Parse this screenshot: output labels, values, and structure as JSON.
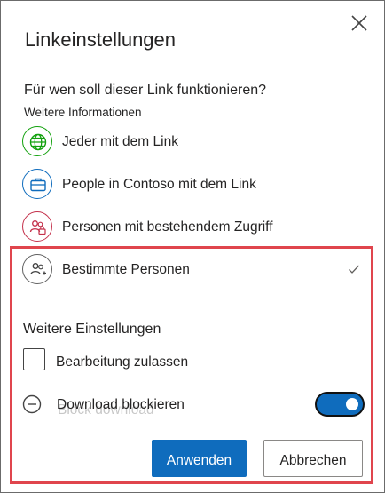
{
  "dialog": {
    "title": "Linkeinstellungen",
    "close_icon": "close-icon"
  },
  "audience": {
    "question": "Für wen soll dieser Link funktionieren?",
    "more_info": "Weitere Informationen",
    "options": [
      {
        "label": "Jeder mit dem Link",
        "icon": "globe-icon",
        "color": "#13a10e",
        "selected": false
      },
      {
        "label": "People in Contoso mit dem Link",
        "icon": "briefcase-icon",
        "color": "#0f6cbd",
        "selected": false
      },
      {
        "label": "Personen mit bestehendem Zugriff",
        "icon": "people-lock-icon",
        "color": "#c4314b",
        "selected": false
      },
      {
        "label": "Bestimmte Personen",
        "icon": "people-add-icon",
        "color": "#616161",
        "selected": true
      }
    ]
  },
  "settings": {
    "title": "Weitere Einstellungen",
    "allow_edit": {
      "label": "Bearbeitung zulassen",
      "checked": false
    },
    "block_download": {
      "label": "Download blockieren",
      "ghost_label": "Block download",
      "toggle_on": true
    }
  },
  "actions": {
    "apply": "Anwenden",
    "cancel": "Abbrechen"
  },
  "colors": {
    "accent": "#0f6cbd",
    "highlight": "#e0454d"
  }
}
